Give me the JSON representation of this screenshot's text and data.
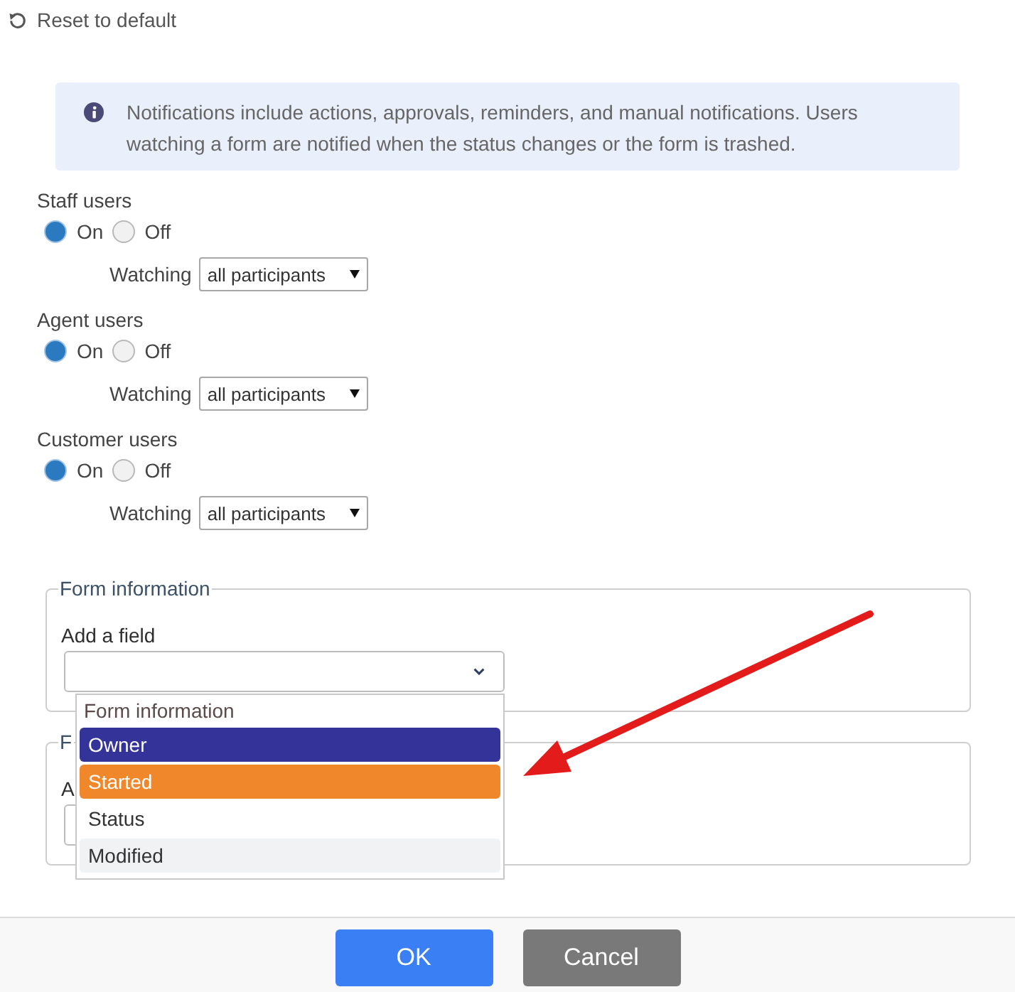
{
  "reset_link": {
    "label": "Reset to default"
  },
  "info_banner": {
    "text": "Notifications include actions, approvals, reminders, and manual notifications. Users watching a form are notified when the status changes or the form is trashed."
  },
  "user_groups": [
    {
      "label": "Staff users",
      "options": [
        {
          "label": "On",
          "selected": true
        },
        {
          "label": "Off",
          "selected": false
        }
      ],
      "watching": {
        "label": "Watching",
        "value": "all participants"
      }
    },
    {
      "label": "Agent users",
      "options": [
        {
          "label": "On",
          "selected": true
        },
        {
          "label": "Off",
          "selected": false
        }
      ],
      "watching": {
        "label": "Watching",
        "value": "all participants"
      }
    },
    {
      "label": "Customer users",
      "options": [
        {
          "label": "On",
          "selected": true
        },
        {
          "label": "Off",
          "selected": false
        }
      ],
      "watching": {
        "label": "Watching",
        "value": "all participants"
      }
    }
  ],
  "sections": [
    {
      "legend": "Form information",
      "label": "Add a field",
      "menu": {
        "group_label": "Form information",
        "options": [
          {
            "label": "Owner",
            "selected": true,
            "focused": false,
            "shaded": false
          },
          {
            "label": "Started",
            "selected": false,
            "focused": true,
            "shaded": false
          },
          {
            "label": "Status",
            "selected": false,
            "focused": false,
            "shaded": false
          },
          {
            "label": "Modified",
            "selected": false,
            "focused": false,
            "shaded": true
          }
        ]
      }
    },
    {
      "legend": "F",
      "label": "A"
    }
  ],
  "buttons": [
    {
      "label": "OK",
      "kind": "primary"
    },
    {
      "label": "Cancel",
      "kind": "secondary"
    }
  ]
}
